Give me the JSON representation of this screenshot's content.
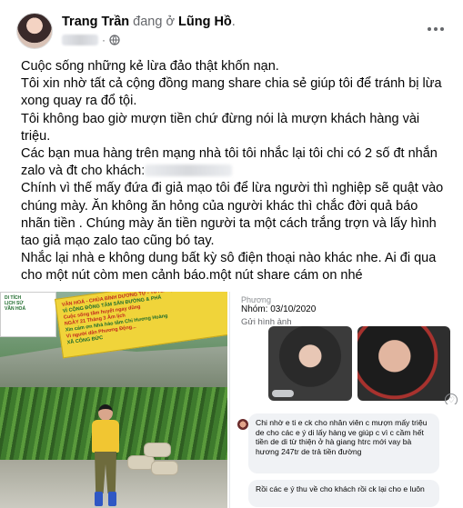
{
  "post": {
    "author": "Trang Trần",
    "verb": "đang ở",
    "location": "Lũng Hồ",
    "location_suffix": ".",
    "time_separator": "·",
    "privacy_icon": "globe-icon",
    "more_icon": "more-options-icon",
    "body": {
      "p1": "Cuộc sống những kẻ lừa đảo thật khốn nạn.",
      "p2": "Tôi xin nhờ tất cả cộng đồng mang share chia sẻ giúp tôi để tránh bị lừa xong quay ra đổ tội.",
      "p3": "Tôi không bao giờ mượn tiền chứ đừng nói là mượn khách hàng vài triệu.",
      "p4": "Các bạn mua hàng trên mạng nhà tôi tôi nhắc lại tôi chi có 2 số đt nhắn zalo và đt cho khách:",
      "p5": "Chính vì thế mấy đứa đi giả mạo tôi để lừa người thì nghiệp sẽ quật vào chúng mày. Ăn không ăn hỏng của người khác thì chắc đời quả báo nhãn tiền . Chúng mày ăn tiền người ta một cách trắng trợn và lấy hình tao giả mạo zalo tao cũng bó tay.",
      "p6": "Nhắc lại nhà e không dung bất kỳ sô điện thoại nào khác nhe. Ai đi qua cho một nút còm men cảnh báo.một nút share cám on nhé"
    }
  },
  "photos": {
    "left": {
      "sign": [
        "DI TÍCH",
        "LỊCH SỬ",
        "VĂN HOÁ"
      ],
      "banner": [
        "VĂN HOÁ - CHÙA BÌNH DƯƠNG TỰ - TUYÊN QUANG",
        "VÌ CỘNG ĐỒNG TÂM SẮN ĐƯỜNG & PHÁ",
        "Cuộc sống tâm huyết ngay dũng",
        "NGÀY 21 Tháng 3 Âm lịch",
        "Xin cảm ơn Nhà hảo tâm Chi Hương Hoàng",
        "Vì người dân Phương Động...",
        "XÃ CÔNG ĐỨC"
      ]
    },
    "right": {
      "sender_label": "Phương",
      "group_date": "Nhóm: 03/10/2020",
      "sent_images": "Gửi hình ảnh",
      "heart_icon": "♡",
      "message1": "Chi nhờ e ti e ck cho nhân viên c mượn mấy triệu de cho các e ý di lấy hàng ve giúp c vì c cầm hết tiền de di từ thiện ở hà giang htrc mới vay bà hương 247tr de trả tiền đường",
      "message2": "Rồi các e ý thu về cho khách rồi ck lại cho e luôn"
    }
  }
}
